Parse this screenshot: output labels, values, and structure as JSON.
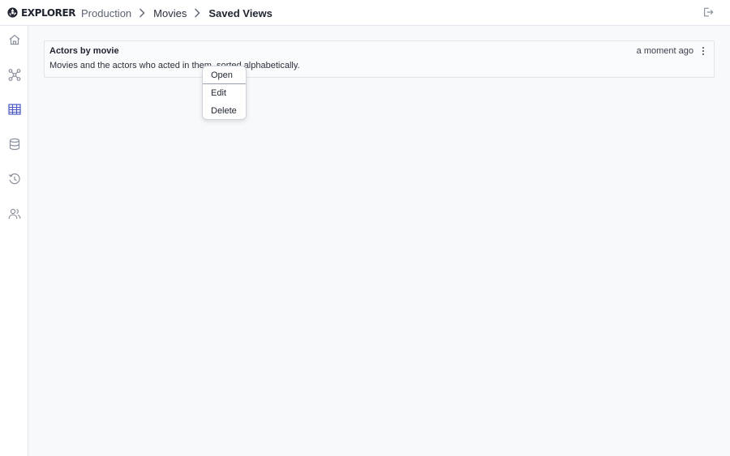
{
  "app": {
    "logo_text": "EXPLORER"
  },
  "breadcrumb": {
    "items": [
      "Production",
      "Movies",
      "Saved Views"
    ]
  },
  "sidebar": {
    "items": [
      "home-icon",
      "graph-icon",
      "table-icon",
      "database-icon",
      "history-icon",
      "users-icon"
    ],
    "active": "table-icon"
  },
  "saved_view": {
    "title": "Actors by movie",
    "description": "Movies and the actors who acted in them, sorted alphabetically.",
    "timestamp": "a moment ago"
  },
  "context_menu": {
    "items": [
      "Open",
      "Edit",
      "Delete"
    ]
  },
  "colors": {
    "accent": "#4b57c4",
    "icon": "#8a909c"
  }
}
